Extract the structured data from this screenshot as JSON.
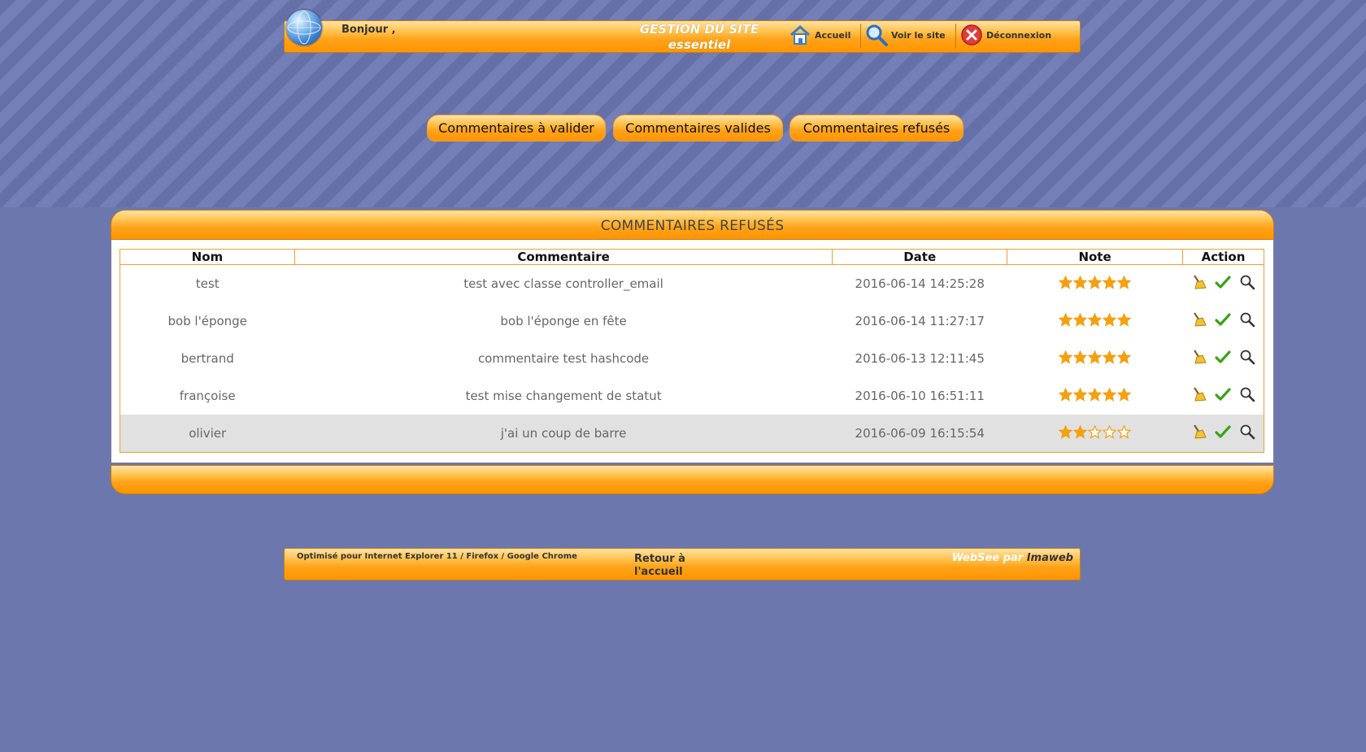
{
  "header": {
    "greeting": "Bonjour ,",
    "site_title_1": "GESTION DU SITE",
    "site_title_2": "essentiel",
    "nav": [
      {
        "label": "Accueil",
        "icon": "home-icon"
      },
      {
        "label": "Voir le site",
        "icon": "magnifier-icon"
      },
      {
        "label": "Déconnexion",
        "icon": "logout-icon"
      }
    ]
  },
  "tabs": [
    {
      "label": "Commentaires à valider"
    },
    {
      "label": "Commentaires valides"
    },
    {
      "label": "Commentaires refusés"
    }
  ],
  "panel": {
    "title": "COMMENTAIRES REFUSÉS",
    "columns": [
      "Nom",
      "Commentaire",
      "Date",
      "Note",
      "Action"
    ],
    "rows": [
      {
        "nom": "test",
        "commentaire": "test avec classe controller_email",
        "date": "2016-06-14 14:25:28",
        "note": 5
      },
      {
        "nom": "bob l'éponge",
        "commentaire": "bob l'éponge en fête",
        "date": "2016-06-14 11:27:17",
        "note": 5
      },
      {
        "nom": "bertrand",
        "commentaire": "commentaire test hashcode",
        "date": "2016-06-13 12:11:45",
        "note": 5
      },
      {
        "nom": "françoise",
        "commentaire": "test mise changement de statut",
        "date": "2016-06-10 16:51:11",
        "note": 5
      },
      {
        "nom": "olivier",
        "commentaire": "j'ai un coup de barre",
        "date": "2016-06-09 16:15:54",
        "note": 2
      }
    ],
    "row_actions": [
      "broom-icon",
      "check-icon",
      "magnifier-icon"
    ],
    "note_max": 5
  },
  "footer": {
    "optimized": "Optimisé pour Internet Explorer 11 / Firefox / Google Chrome",
    "back_1": "Retour à",
    "back_2": "l'accueil",
    "brand_a": "WebSee par",
    "brand_b": "Imaweb"
  },
  "colors": {
    "background": "#6c77ad",
    "accent": "#ffa21a",
    "star": "#f5a011",
    "check": "#3aa21a"
  }
}
